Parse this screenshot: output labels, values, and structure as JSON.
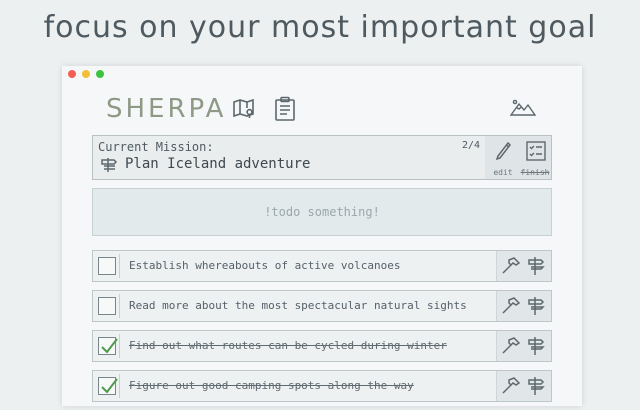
{
  "headline": "focus on your most important goal",
  "app": {
    "brand": "SHERPA",
    "icons": {
      "map": "map-pin-icon",
      "clipboard": "clipboard-icon",
      "mountains": "mountains-icon"
    }
  },
  "mission": {
    "label": "Current Mission:",
    "progress": "2/4",
    "text": "Plan Iceland adventure",
    "edit_label": "edit",
    "finish_label": "finish"
  },
  "todo_input": {
    "placeholder": "!todo something!"
  },
  "tasks": [
    {
      "text": "Establish whereabouts of active volcanoes",
      "done": false
    },
    {
      "text": "Read more about the most spectacular natural sights",
      "done": false
    },
    {
      "text": "Find out what routes can be cycled during winter",
      "done": true
    },
    {
      "text": "Figure out good camping spots along the way",
      "done": true
    }
  ],
  "colors": {
    "background": "#ecf0f1",
    "brand": "#8e9a86",
    "check": "#4c9a4c"
  }
}
